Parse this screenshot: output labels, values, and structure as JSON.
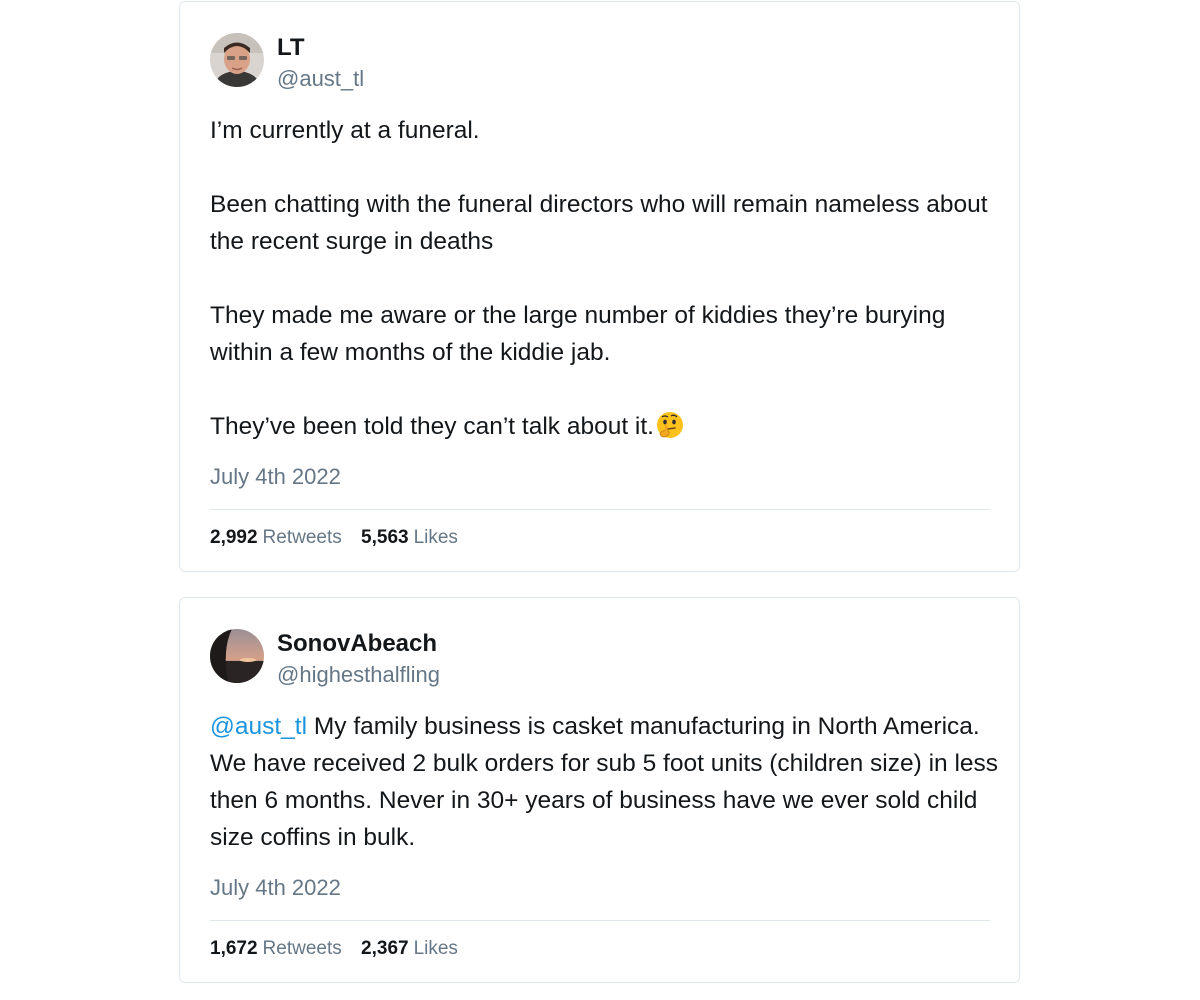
{
  "tweets": [
    {
      "name": "LT",
      "handle": "@aust_tl",
      "avatar_icon": "user-photo-avatar",
      "paragraphs": [
        "I’m currently at a funeral.",
        "Been chatting with the funeral directors who will remain nameless about the recent surge in deaths",
        "They made me aware or the large number of kiddies they’re burying within a few months of the kiddie jab.",
        "They’ve been told they can’t talk about it."
      ],
      "trailing_emoji": "thinking-face-emoji",
      "date": "July 4th 2022",
      "retweets": "2,992",
      "retweets_label": "Retweets",
      "likes": "5,563",
      "likes_label": "Likes"
    },
    {
      "name": "SonovAbeach",
      "handle": "@highesthalfling",
      "avatar_icon": "sunset-photo-avatar",
      "mention": "@aust_tl",
      "text": " My family business is casket manufacturing in North America. We have received 2 bulk orders for sub 5 foot units (children size) in less then 6 months. Never in 30+ years of business have we ever sold child size coffins in bulk.",
      "date": "July 4th 2022",
      "retweets": "1,672",
      "retweets_label": "Retweets",
      "likes": "2,367",
      "likes_label": "Likes"
    }
  ],
  "colors": {
    "text": "#14171a",
    "secondary": "#657786",
    "link": "#1b95e0",
    "border": "#e1e8ed"
  }
}
